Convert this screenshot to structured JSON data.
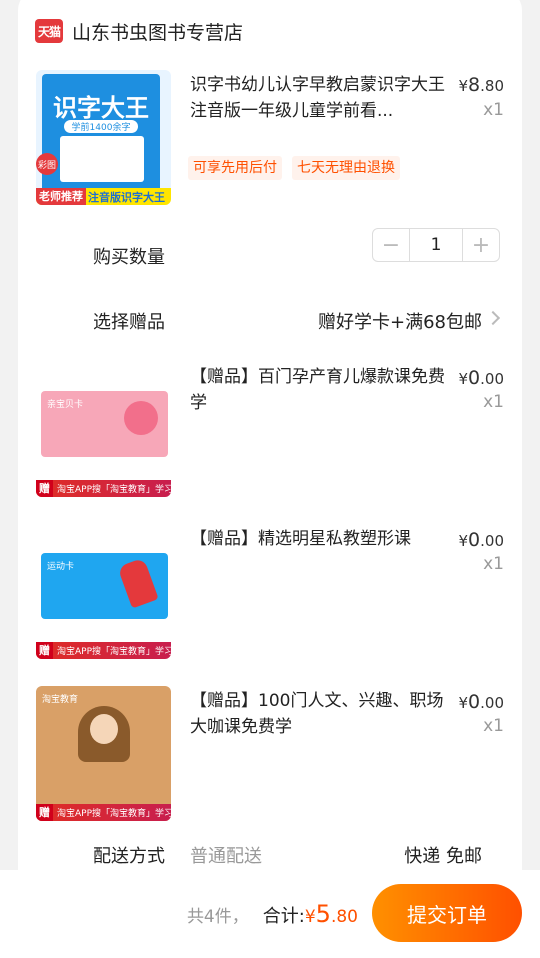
{
  "shop": {
    "badge": "天猫",
    "name": "山东书虫图书专营店"
  },
  "product": {
    "title": "识字书幼儿认字早教启蒙识字大王注音版一年级儿童学前看...",
    "price_symbol": "¥",
    "price_int": "8",
    "price_dec": ".80",
    "qty": "x1",
    "tags": [
      "可享先用后付",
      "七天无理由退换"
    ],
    "cover": {
      "title": "识字大王",
      "subtitle": "学前1400余字",
      "badge": "彩图",
      "footer_left": "老师推荐",
      "footer_right": "注音版识字大王"
    }
  },
  "quantity": {
    "label": "购买数量",
    "minus": "−",
    "value": "1",
    "plus": "+"
  },
  "gift_select": {
    "label": "选择赠品",
    "value": "赠好学卡+满68包邮"
  },
  "gifts": [
    {
      "title": "【赠品】百门孕产育儿爆款课免费学",
      "price_symbol": "¥",
      "price_int": "0",
      "price_dec": ".00",
      "qty": "x1",
      "card_title": "亲宝贝卡",
      "card_color": "#f7a7b8",
      "tag": "赠品课",
      "tag_sub": "淘宝APP搜「淘宝教育」学习"
    },
    {
      "title": "【赠品】精选明星私教塑形课",
      "price_symbol": "¥",
      "price_int": "0",
      "price_dec": ".00",
      "qty": "x1",
      "card_title": "运动卡",
      "card_color": "#1fa6f0",
      "tag": "赠品课",
      "tag_sub": "淘宝APP搜「淘宝教育」学习"
    },
    {
      "title": "【赠品】100门人文、兴趣、职场大咖课免费学",
      "price_symbol": "¥",
      "price_int": "0",
      "price_dec": ".00",
      "qty": "x1",
      "card_title": "淘宝教育",
      "card_color": "#d9a067",
      "tag": "赠品课",
      "tag_sub": "淘宝APP搜「淘宝教育」学习"
    }
  ],
  "delivery": {
    "label": "配送方式",
    "mode": "普通配送",
    "value": "快递 免邮"
  },
  "footer": {
    "count": "共4件，",
    "total_label": "合计:",
    "total_symbol": "¥",
    "total_int": "5",
    "total_dec": ".80",
    "submit": "提交订单"
  },
  "colors": {
    "accent": "#ff5000",
    "tmall_red": "#e4393c"
  }
}
